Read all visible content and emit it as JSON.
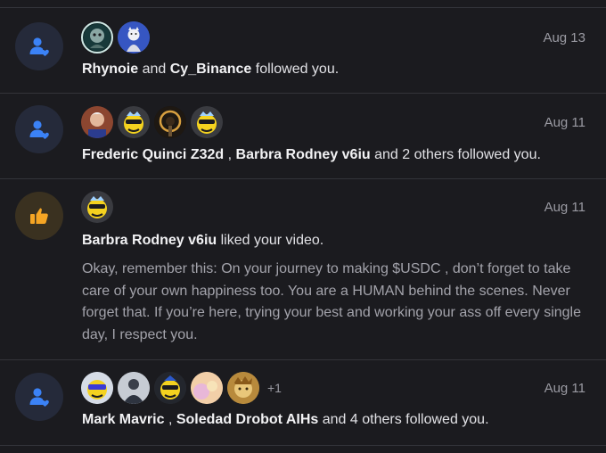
{
  "notifications": [
    {
      "type": "follow",
      "date": "Aug 13",
      "user1": "Rhynoie",
      "sep": "and",
      "user2": "Cy_Binance",
      "rest": "followed you."
    },
    {
      "type": "follow",
      "date": "Aug 11",
      "user1": "Frederic Quinci Z32d",
      "sep": ",",
      "user2": "Barbra Rodney v6iu",
      "rest": "and 2 others followed you."
    },
    {
      "type": "like",
      "date": "Aug 11",
      "user1": "Barbra Rodney v6iu",
      "rest": "liked your video.",
      "comment": "Okay, remember this: On your journey to making $USDC , don’t forget to take care of your own happiness too. You are a HUMAN behind the scenes. Never forget that. If you’re here, trying your best and working your ass off every single day, I respect you."
    },
    {
      "type": "follow",
      "date": "Aug 11",
      "more": "+1",
      "user1": "Mark Mavric",
      "sep": ",",
      "user2": "Soledad Drobot AIHs",
      "rest": "and 4 others followed you."
    }
  ],
  "icons": {
    "follow": "person-add-icon",
    "like": "thumbs-up-icon"
  },
  "colors": {
    "background": "#1b1b1f",
    "follow_icon": "#3b82f6",
    "like_icon": "#f5a524",
    "muted_text": "#9a9aa2"
  }
}
